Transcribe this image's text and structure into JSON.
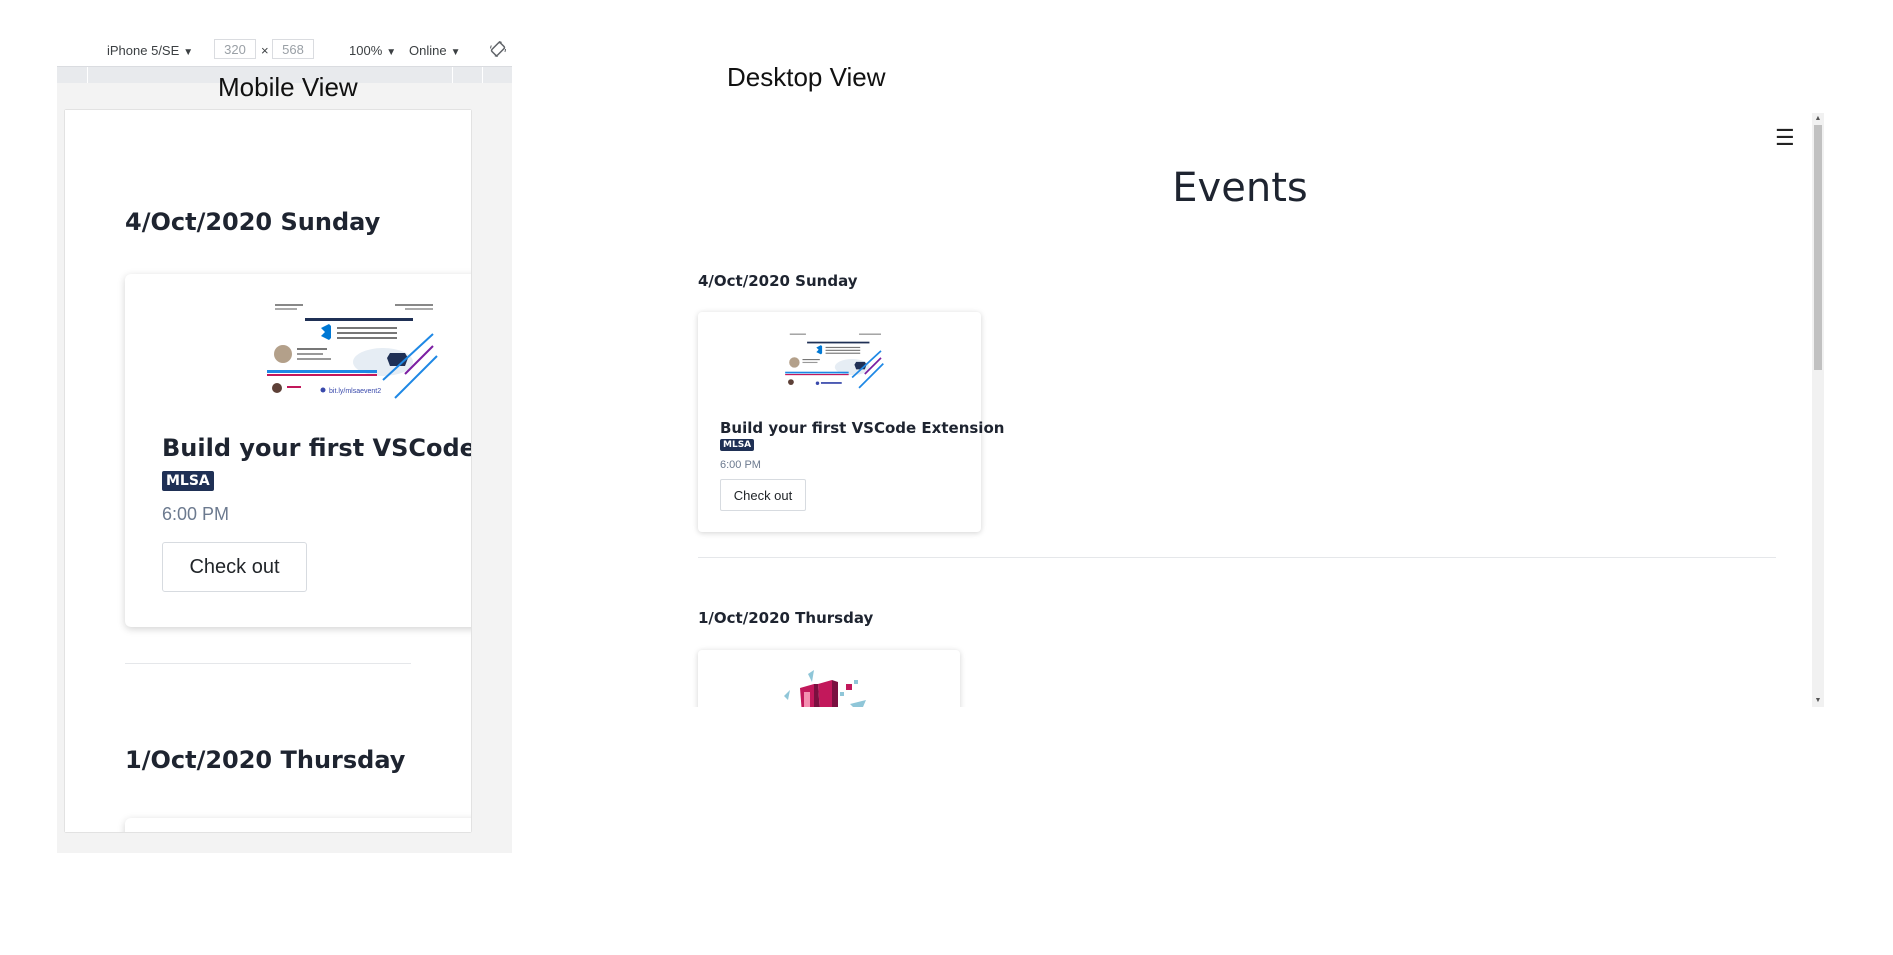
{
  "devtools": {
    "device": "iPhone 5/SE",
    "width": "320",
    "times": "×",
    "height": "568",
    "zoom": "100%",
    "throttle": "Online"
  },
  "labels": {
    "mobile_view": "Mobile View",
    "desktop_view": "Desktop View"
  },
  "mobile": {
    "events": [
      {
        "date": "4/Oct/2020 Sunday",
        "title": "Build your first VSCode Extension",
        "badge": "MLSA",
        "time": "6:00 PM",
        "button": "Check out"
      },
      {
        "date": "1/Oct/2020 Thursday"
      }
    ]
  },
  "desktop": {
    "menu_icon": "☰",
    "heading": "Events",
    "events": [
      {
        "date": "4/Oct/2020 Sunday",
        "title": "Build your first VSCode Extension",
        "badge": "MLSA",
        "time": "6:00 PM",
        "button": "Check out"
      },
      {
        "date": "1/Oct/2020 Thursday"
      }
    ]
  },
  "poster": {
    "title": "Build Your First VS Code Extension",
    "link": "bit.ly/mlsaevent2"
  },
  "colors": {
    "badge": "#1f3055",
    "vscode_blue": "#0078d4",
    "poster_magenta": "#c2185b"
  }
}
